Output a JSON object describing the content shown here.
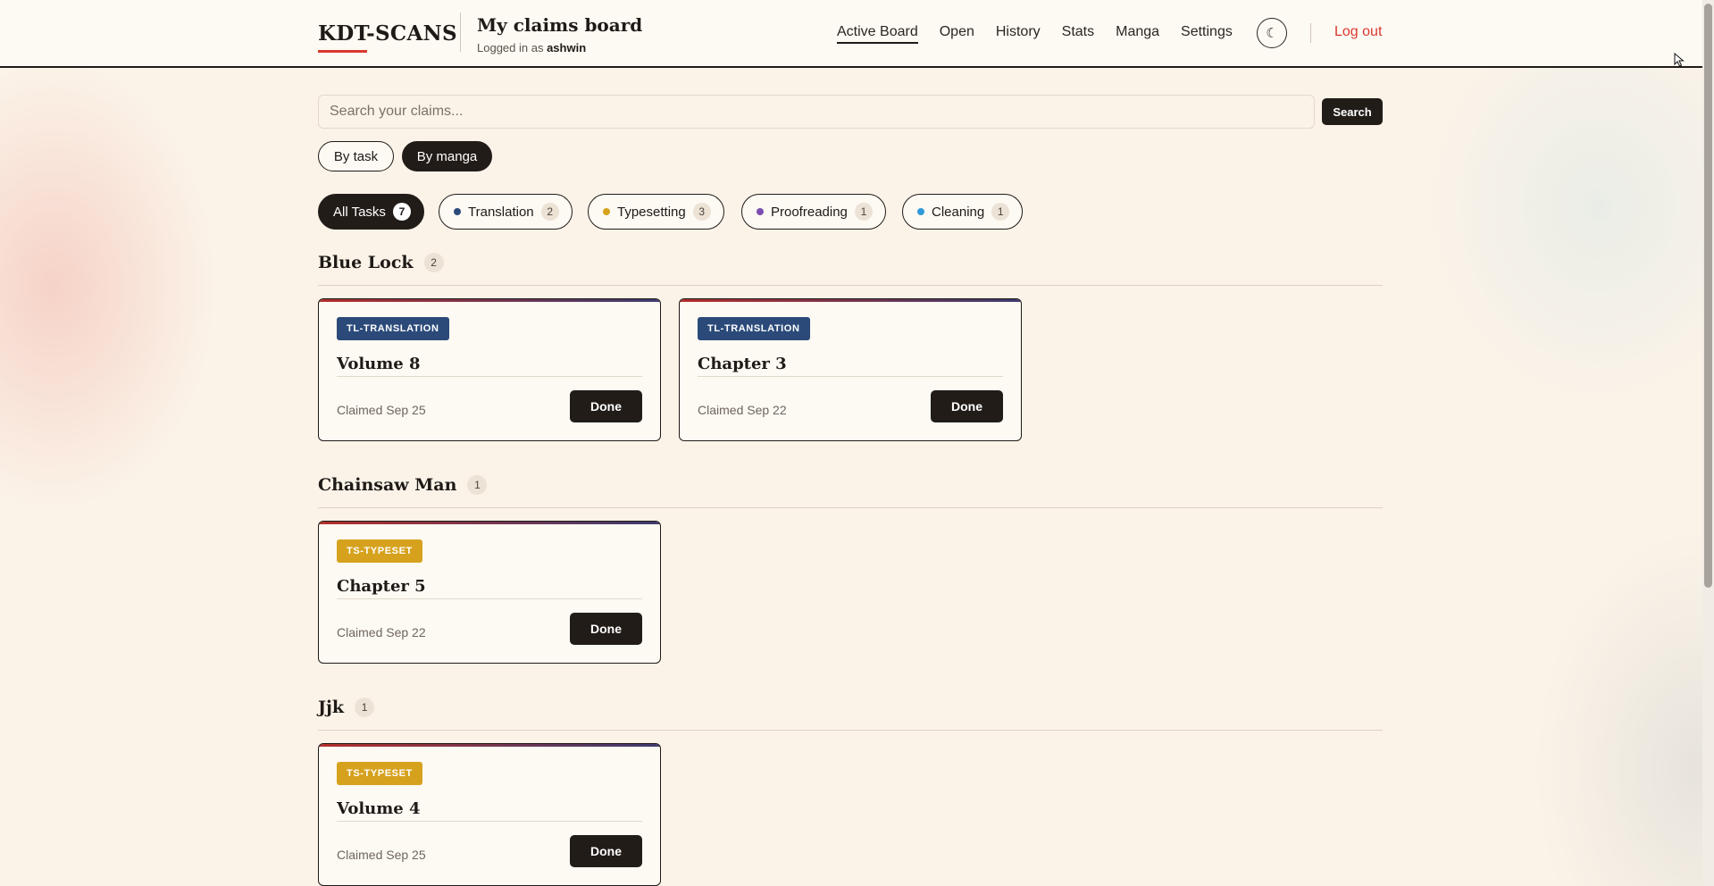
{
  "brand": {
    "name": "KDT-SCANS"
  },
  "header": {
    "title": "My claims board",
    "logged_in_prefix": "Logged in as",
    "username": "ashwin"
  },
  "nav": {
    "items": [
      "Active Board",
      "Open",
      "History",
      "Stats",
      "Manga",
      "Settings"
    ],
    "active": "Active Board",
    "theme_icon": "☾",
    "logout": "Log out"
  },
  "search": {
    "placeholder": "Search your claims...",
    "value": "",
    "button": "Search"
  },
  "view_toggle": {
    "by_task": "By task",
    "by_manga": "By manga",
    "selected": "By manga"
  },
  "filters": [
    {
      "label": "All Tasks",
      "count": "7",
      "active": true,
      "color": ""
    },
    {
      "label": "Translation",
      "count": "2",
      "active": false,
      "color": "#2b4a7a"
    },
    {
      "label": "Typesetting",
      "count": "3",
      "active": false,
      "color": "#d6a21e"
    },
    {
      "label": "Proofreading",
      "count": "1",
      "active": false,
      "color": "#7a4fb0"
    },
    {
      "label": "Cleaning",
      "count": "1",
      "active": false,
      "color": "#2f9ad8"
    }
  ],
  "groups": [
    {
      "title": "Blue Lock",
      "count": "2",
      "cards": [
        {
          "tag": "TL-TRANSLATION",
          "tag_type": "tl",
          "title": "Volume 8",
          "claimed": "Claimed Sep 25",
          "action": "Done"
        },
        {
          "tag": "TL-TRANSLATION",
          "tag_type": "tl",
          "title": "Chapter 3",
          "claimed": "Claimed Sep 22",
          "action": "Done"
        }
      ]
    },
    {
      "title": "Chainsaw Man",
      "count": "1",
      "cards": [
        {
          "tag": "TS-TYPESET",
          "tag_type": "ts",
          "title": "Chapter 5",
          "claimed": "Claimed Sep 22",
          "action": "Done"
        }
      ]
    },
    {
      "title": "Jjk",
      "count": "1",
      "cards": [
        {
          "tag": "TS-TYPESET",
          "tag_type": "ts",
          "title": "Volume 4",
          "claimed": "Claimed Sep 25",
          "action": "Done"
        }
      ]
    }
  ],
  "colors": {
    "accent": "#d9382e",
    "dark": "#221c19",
    "translation": "#2b4a7a",
    "typeset": "#d6a21e",
    "background": "#fbf3e8"
  }
}
